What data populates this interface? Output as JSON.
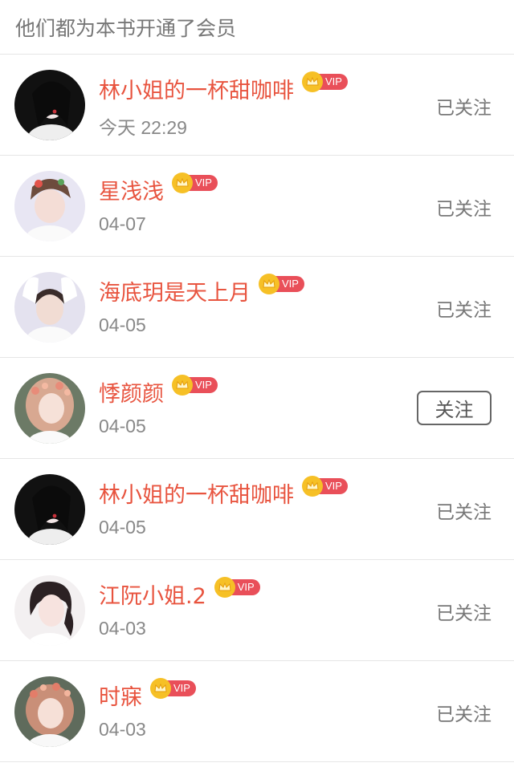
{
  "header": {
    "title": "他们都为本书开通了会员"
  },
  "vip_label": "VIP",
  "colors": {
    "name": "#e8543f",
    "vip_crown": "#f6c026",
    "vip_badge": "#e94f59"
  },
  "members": [
    {
      "name": "林小姐的一杯甜咖啡",
      "time": "今天 22:29",
      "followed": true,
      "follow_label": "已关注",
      "avatar": "avatar-1"
    },
    {
      "name": "星浅浅",
      "time": "04-07",
      "followed": true,
      "follow_label": "已关注",
      "avatar": "avatar-2"
    },
    {
      "name": "海底玥是天上月",
      "time": "04-05",
      "followed": true,
      "follow_label": "已关注",
      "avatar": "avatar-3"
    },
    {
      "name": "悸颜颜",
      "time": "04-05",
      "followed": false,
      "follow_label": "关注",
      "avatar": "avatar-4"
    },
    {
      "name": "林小姐的一杯甜咖啡",
      "time": "04-05",
      "followed": true,
      "follow_label": "已关注",
      "avatar": "avatar-1"
    },
    {
      "name": "江阮小姐.2",
      "time": "04-03",
      "followed": true,
      "follow_label": "已关注",
      "avatar": "avatar-5"
    },
    {
      "name": "时寐",
      "time": "04-03",
      "followed": true,
      "follow_label": "已关注",
      "avatar": "avatar-6"
    }
  ]
}
